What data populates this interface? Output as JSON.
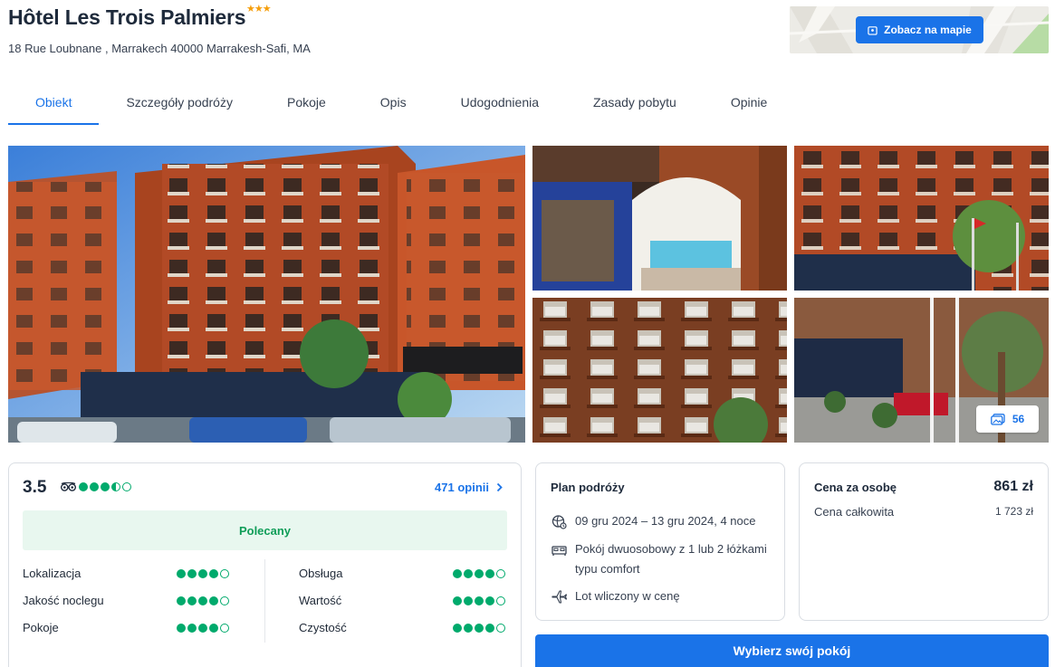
{
  "hotel": {
    "name": "Hôtel Les Trois Palmiers",
    "stars": "★★★",
    "address": "18 Rue Loubnane , Marrakech 40000 Marrakesh-Safi, MA"
  },
  "map": {
    "button_label": "Zobacz na mapie"
  },
  "tabs": [
    {
      "label": "Obiekt",
      "active": true
    },
    {
      "label": "Szczegóły podróży"
    },
    {
      "label": "Pokoje"
    },
    {
      "label": "Opis"
    },
    {
      "label": "Udogodnienia"
    },
    {
      "label": "Zasady pobytu"
    },
    {
      "label": "Opinie"
    }
  ],
  "gallery": {
    "photo_count": "56"
  },
  "rating": {
    "score": "3.5",
    "bubbles": 3.5,
    "reviews_link": "471 opinii",
    "badge": "Polecany",
    "criteria": [
      {
        "label": "Lokalizacja",
        "bubbles": 4
      },
      {
        "label": "Jakość noclegu",
        "bubbles": 4
      },
      {
        "label": "Pokoje",
        "bubbles": 4
      },
      {
        "label": "Obsługa",
        "bubbles": 4
      },
      {
        "label": "Wartość",
        "bubbles": 4
      },
      {
        "label": "Czystość",
        "bubbles": 4
      }
    ]
  },
  "plan": {
    "title": "Plan podróży",
    "dates": "09 gru 2024 – 13 gru 2024, 4 noce",
    "room": "Pokój dwuosobowy z 1 lub 2 łóżkami typu comfort",
    "flight": "Lot wliczony w cenę"
  },
  "price": {
    "per_person_label": "Cena za osobę",
    "per_person_value": "861 zł",
    "total_label": "Cena całkowita",
    "total_value": "1 723 zł"
  },
  "cta": {
    "label": "Wybierz swój pokój"
  },
  "colors": {
    "accent": "#1a73e8",
    "tripadvisor_green": "#00aa6c",
    "recommended_bg": "#e8f7ef"
  }
}
